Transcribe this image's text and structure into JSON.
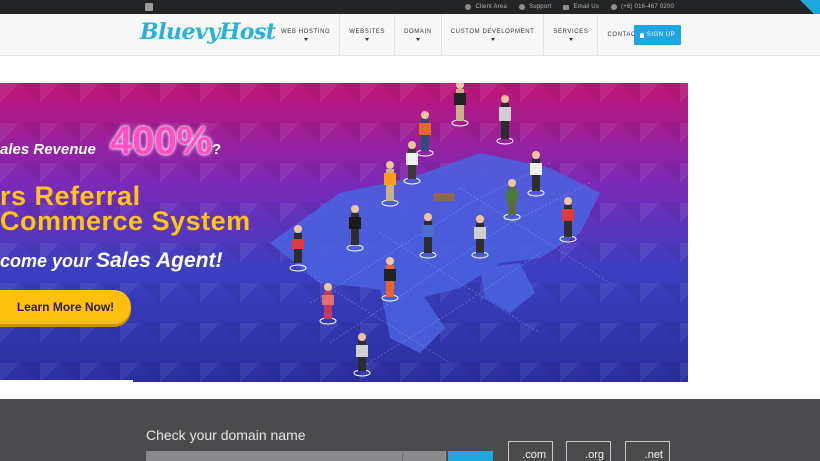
{
  "topbar": {
    "links": [
      {
        "icon": "user-icon",
        "label": "Client Area"
      },
      {
        "icon": "support-icon",
        "label": "Support"
      },
      {
        "icon": "email-icon",
        "label": "Email Us"
      },
      {
        "icon": "phone-icon",
        "label": "(+6) 016-467 0200"
      }
    ]
  },
  "header": {
    "logo": "BluevyHost",
    "nav": [
      "WEB HOSTING",
      "WEBSITES",
      "DOMAIN",
      "CUSTOM DEVELOPMENT",
      "SERVICES",
      "CONTACT US"
    ],
    "signup": "SIGN UP"
  },
  "banner": {
    "line1": "ales Revenue",
    "percent": "400%",
    "question": "?",
    "line2": "rs Referral",
    "line3": "Commerce System",
    "line4_prefix": "come your",
    "line4_emph": "Sales Agent!",
    "cta": "Learn More Now!"
  },
  "domain": {
    "title": "Check your domain name",
    "tlds": [
      ".com",
      ".org",
      ".net"
    ]
  },
  "colors": {
    "brand": "#1ea6df",
    "topbar": "#222426",
    "banner_yellow": "#ffc512",
    "banner_pink": "#ff4fc2",
    "domain_bg": "#4b4b4d"
  }
}
